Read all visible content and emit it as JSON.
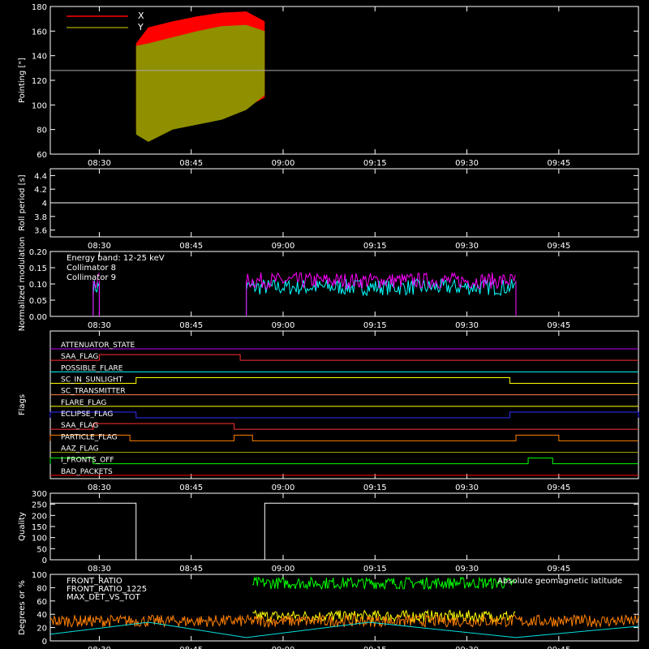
{
  "time_ticks": [
    "08:30",
    "08:45",
    "09:00",
    "09:15",
    "09:30",
    "09:45"
  ],
  "chart_data": [
    {
      "type": "area",
      "ylabel": "Pointing [\"]",
      "ylim": [
        60,
        180
      ],
      "yticks": [
        60,
        80,
        100,
        120,
        140,
        160,
        180
      ],
      "grid": false,
      "legend": "top-left",
      "reference_line": 128,
      "series": [
        {
          "name": "X",
          "color": "#ff0000",
          "x": [
            "08:36",
            "08:38",
            "08:42",
            "08:46",
            "08:50",
            "08:54",
            "08:57"
          ],
          "upper": [
            150,
            163,
            168,
            172,
            175,
            176,
            168
          ],
          "lower": [
            80,
            82,
            88,
            90,
            92,
            98,
            106
          ]
        },
        {
          "name": "Y",
          "color": "#8f8f00",
          "x": [
            "08:36",
            "08:38",
            "08:42",
            "08:46",
            "08:50",
            "08:54",
            "08:57"
          ],
          "upper": [
            148,
            150,
            155,
            160,
            164,
            165,
            160
          ],
          "lower": [
            76,
            70,
            80,
            84,
            88,
            96,
            108
          ]
        }
      ]
    },
    {
      "type": "line",
      "ylabel": "Roll period [s]",
      "ylim": [
        3.5,
        4.5
      ],
      "yticks": [
        3.6,
        3.8,
        4.0,
        4.2,
        4.4
      ],
      "grid": false,
      "series": [
        {
          "color": "#ffffff",
          "x": [
            "08:22",
            "09:58"
          ],
          "y": [
            4.0,
            4.0
          ]
        }
      ]
    },
    {
      "type": "line",
      "ylabel": "Normalized modulation",
      "ylim": [
        0,
        0.2
      ],
      "yticks": [
        "0.00",
        "0.05",
        "0.10",
        "0.15",
        "0.20"
      ],
      "grid": false,
      "legend": "top-left",
      "annotation": "Energy band: 12-25 keV",
      "series": [
        {
          "name": "Collimator 8",
          "color": "#00ffff",
          "segments": [
            [
              "08:29",
              "08:30"
            ],
            [
              "08:54",
              "09:38"
            ]
          ],
          "y": 0.09
        },
        {
          "name": "Collimator 9",
          "color": "#ff00ff",
          "segments": [
            [
              "08:29",
              "08:30"
            ],
            [
              "08:54",
              "09:38"
            ]
          ],
          "y": 0.11
        }
      ]
    },
    {
      "type": "line",
      "ylabel": "Flags",
      "grid": false,
      "flags": [
        {
          "name": "ATTENUATOR_STATE",
          "color": "#c000ff",
          "high": []
        },
        {
          "name": "SAA_FLAG",
          "color": "#ff3030",
          "high": [
            [
              "08:30",
              "08:53"
            ]
          ]
        },
        {
          "name": "POSSIBLE_FLARE",
          "color": "#00ffff",
          "high": []
        },
        {
          "name": "SC_IN_SUNLIGHT",
          "color": "#ffff00",
          "high": [
            [
              "08:36",
              "09:37"
            ]
          ]
        },
        {
          "name": "SC_TRANSMITTER",
          "color": "#ff8040",
          "high": []
        },
        {
          "name": "FLARE_FLAG",
          "color": "#ffff00",
          "high": []
        },
        {
          "name": "ECLIPSE_FLAG",
          "color": "#3030ff",
          "high": [
            [
              "08:22",
              "08:36"
            ],
            [
              "09:37",
              "09:58"
            ]
          ]
        },
        {
          "name": "SAA_FLAG",
          "color": "#ff3030",
          "high": [
            [
              "08:29",
              "08:52"
            ]
          ]
        },
        {
          "name": "PARTICLE_FLAG",
          "color": "#ff8000",
          "high": [
            [
              "08:22",
              "08:35"
            ],
            [
              "08:52",
              "08:55"
            ],
            [
              "09:38",
              "09:45"
            ]
          ]
        },
        {
          "name": "AAZ_FLAG",
          "color": "#a0a000",
          "high": []
        },
        {
          "name": "I_FRONTS_OFF",
          "color": "#00ff00",
          "high": [
            [
              "08:22",
              "08:29"
            ],
            [
              "09:40",
              "09:44"
            ]
          ]
        },
        {
          "name": "BAD_PACKETS",
          "color": "#ff0000",
          "high": []
        }
      ]
    },
    {
      "type": "line",
      "ylabel": "Quality",
      "ylim": [
        0,
        300
      ],
      "yticks": [
        0,
        50,
        100,
        150,
        200,
        250,
        300
      ],
      "grid": false,
      "series": [
        {
          "color": "#ffffff",
          "x": [
            "08:22",
            "08:36",
            "08:36",
            "08:57",
            "08:57",
            "09:58"
          ],
          "y": [
            255,
            255,
            0,
            0,
            255,
            255
          ]
        }
      ]
    },
    {
      "type": "line",
      "ylabel": "Degrees or %",
      "ylim": [
        0,
        100
      ],
      "yticks": [
        0,
        20,
        40,
        60,
        80,
        100
      ],
      "grid": false,
      "legend": "top-left",
      "series": [
        {
          "name": "FRONT_RATIO",
          "color": "#ffff00",
          "x": [
            "08:55",
            "09:38"
          ],
          "y": [
            37,
            37
          ]
        },
        {
          "name": "FRONT_RATIO_1225",
          "color": "#00ff00",
          "x": [
            "08:55",
            "09:38"
          ],
          "y": [
            87,
            87
          ]
        },
        {
          "name": "MAX_DET_VS_TOT",
          "color": "#ff8000",
          "x": [
            "08:22",
            "09:58"
          ],
          "y": [
            30,
            30
          ]
        },
        {
          "name": "Absolute geomagnetic latitude",
          "color": "#00e0e0",
          "x": [
            "08:22",
            "08:38",
            "08:54",
            "09:14",
            "09:38",
            "09:58"
          ],
          "y": [
            10,
            28,
            5,
            28,
            5,
            22
          ]
        }
      ]
    }
  ]
}
